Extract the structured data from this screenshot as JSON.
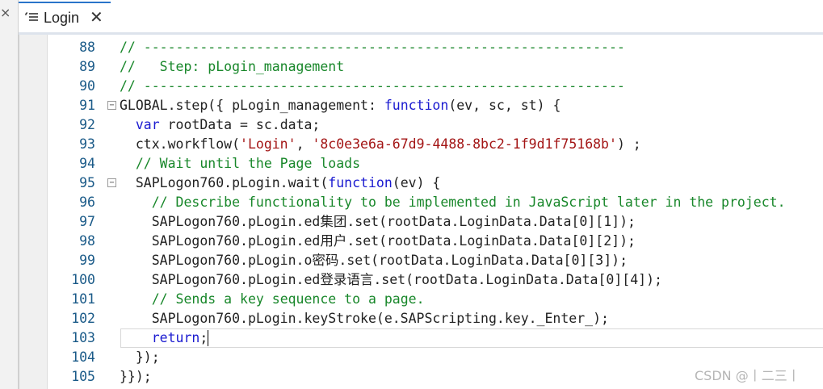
{
  "side": {
    "close_glyph": "×"
  },
  "tab": {
    "label": "Login",
    "icon": "workflow-list-icon",
    "close_glyph": "✕",
    "accent": "#2a74c9"
  },
  "editor": {
    "lines": [
      {
        "num": "88",
        "fold": "",
        "parts": [
          [
            "c-comment",
            "// ------------------------------------------------------------"
          ]
        ]
      },
      {
        "num": "89",
        "fold": "",
        "parts": [
          [
            "c-comment",
            "//   Step: pLogin_management"
          ]
        ]
      },
      {
        "num": "90",
        "fold": "",
        "parts": [
          [
            "c-comment",
            "// ------------------------------------------------------------"
          ]
        ]
      },
      {
        "num": "91",
        "fold": "−",
        "parts": [
          [
            "",
            "GLOBAL.step({ pLogin_management: "
          ],
          [
            "c-kw",
            "function"
          ],
          [
            "",
            "(ev, sc, st) {"
          ]
        ]
      },
      {
        "num": "92",
        "fold": "",
        "parts": [
          [
            "",
            "  "
          ],
          [
            "c-kw",
            "var"
          ],
          [
            "",
            " rootData = sc.data;"
          ]
        ]
      },
      {
        "num": "93",
        "fold": "",
        "parts": [
          [
            "",
            "  ctx.workflow("
          ],
          [
            "c-str",
            "'Login'"
          ],
          [
            "",
            ", "
          ],
          [
            "c-str",
            "'8c0e3e6a-67d9-4488-8bc2-1f9d1f75168b'"
          ],
          [
            "",
            ") ;"
          ]
        ]
      },
      {
        "num": "94",
        "fold": "",
        "parts": [
          [
            "",
            "  "
          ],
          [
            "c-comment",
            "// Wait until the Page loads"
          ]
        ]
      },
      {
        "num": "95",
        "fold": "−",
        "parts": [
          [
            "",
            "  SAPLogon760.pLogin.wait("
          ],
          [
            "c-kw",
            "function"
          ],
          [
            "",
            "(ev) {"
          ]
        ]
      },
      {
        "num": "96",
        "fold": "",
        "parts": [
          [
            "",
            "    "
          ],
          [
            "c-comment",
            "// Describe functionality to be implemented in JavaScript later in the project."
          ]
        ]
      },
      {
        "num": "97",
        "fold": "",
        "parts": [
          [
            "",
            "    SAPLogon760.pLogin.ed集团.set(rootData.LoginData.Data[0][1]);"
          ]
        ]
      },
      {
        "num": "98",
        "fold": "",
        "parts": [
          [
            "",
            "    SAPLogon760.pLogin.ed用户.set(rootData.LoginData.Data[0][2]);"
          ]
        ]
      },
      {
        "num": "99",
        "fold": "",
        "parts": [
          [
            "",
            "    SAPLogon760.pLogin.o密码.set(rootData.LoginData.Data[0][3]);"
          ]
        ]
      },
      {
        "num": "100",
        "fold": "",
        "parts": [
          [
            "",
            "    SAPLogon760.pLogin.ed登录语言.set(rootData.LoginData.Data[0][4]);"
          ]
        ]
      },
      {
        "num": "101",
        "fold": "",
        "parts": [
          [
            "",
            "    "
          ],
          [
            "c-comment",
            "// Sends a key sequence to a page."
          ]
        ]
      },
      {
        "num": "102",
        "fold": "",
        "parts": [
          [
            "",
            "    SAPLogon760.pLogin.keyStroke(e.SAPScripting.key._Enter_);"
          ]
        ]
      },
      {
        "num": "103",
        "fold": "",
        "parts": [
          [
            "",
            "    "
          ],
          [
            "c-kw",
            "return"
          ],
          [
            "",
            ";"
          ]
        ]
      },
      {
        "num": "104",
        "fold": "",
        "parts": [
          [
            "",
            "  });"
          ]
        ]
      },
      {
        "num": "105",
        "fold": "",
        "parts": [
          [
            "",
            "}});"
          ]
        ]
      }
    ],
    "current_line": "103"
  },
  "watermark": "CSDN @丨二三丨"
}
